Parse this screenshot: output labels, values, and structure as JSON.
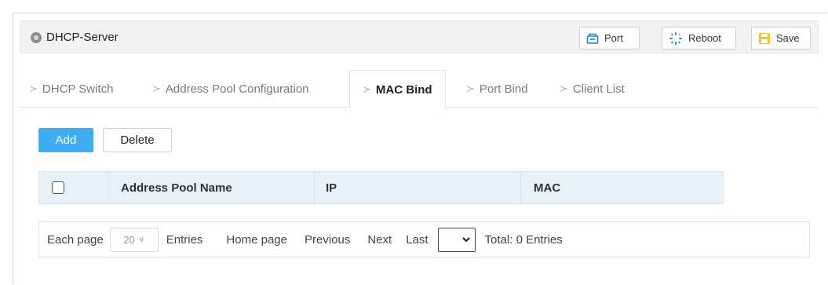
{
  "window": {
    "title": "DHCP-Server"
  },
  "toolbar": {
    "port_label": "Port",
    "reboot_label": "Reboot",
    "save_label": "Save"
  },
  "tabs": [
    {
      "label": "DHCP Switch",
      "active": false
    },
    {
      "label": "Address Pool Configuration",
      "active": false
    },
    {
      "label": "MAC Bind",
      "active": true
    },
    {
      "label": "Port Bind",
      "active": false
    },
    {
      "label": "Client List",
      "active": false
    }
  ],
  "actions": {
    "add_label": "Add",
    "delete_label": "Delete"
  },
  "table": {
    "columns": [
      "Address Pool Name",
      "IP",
      "MAC"
    ],
    "rows": []
  },
  "pager": {
    "each_page_label": "Each page",
    "page_size": "20",
    "entries_label": "Entries",
    "home_label": "Home page",
    "previous_label": "Previous",
    "next_label": "Next",
    "last_label": "Last",
    "total_label": "Total: 0 Entries"
  },
  "colors": {
    "primary": "#3eaef4",
    "header_bg": "#e9f1f8",
    "titlebar_bg": "#f2f2f2"
  },
  "icons": {
    "port": "port-icon",
    "reboot": "reboot-icon",
    "save": "save-icon",
    "title": "status-dot-icon"
  }
}
